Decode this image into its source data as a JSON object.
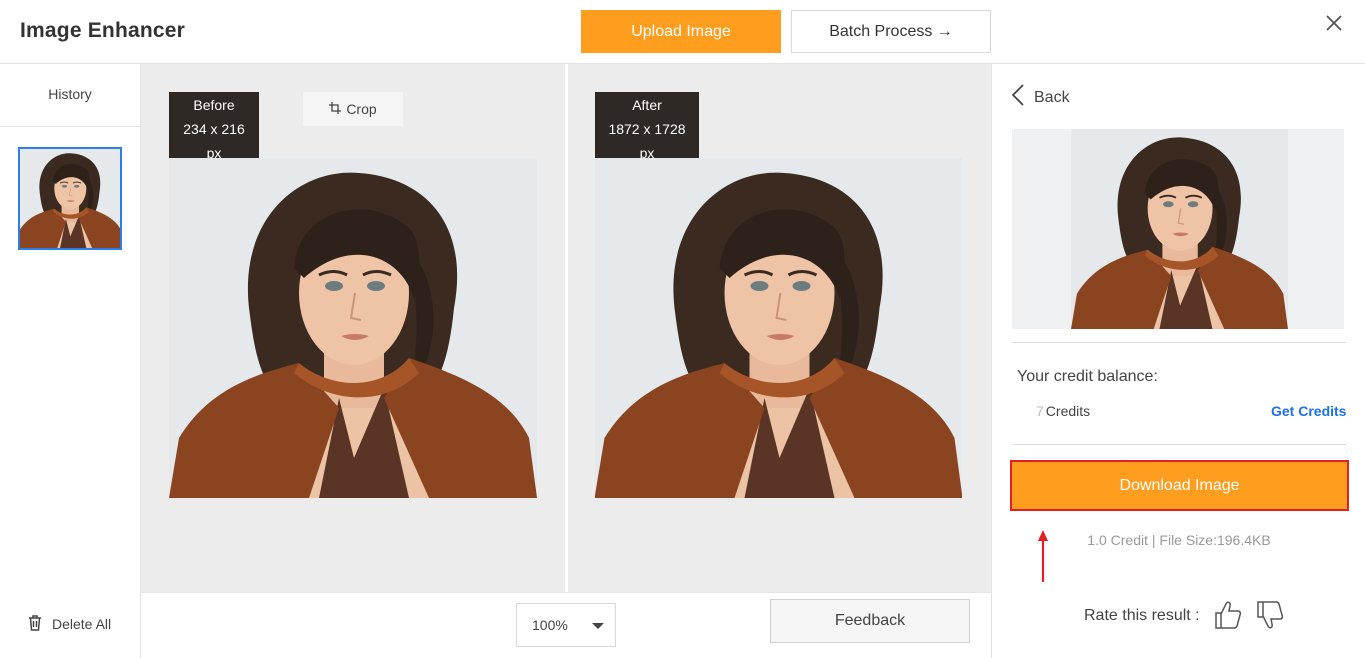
{
  "header": {
    "title": "Image Enhancer",
    "upload_label": "Upload Image",
    "batch_label": "Batch Process →"
  },
  "sidebar": {
    "history_label": "History",
    "delete_label": "Delete All"
  },
  "compare": {
    "before_label": "Before",
    "before_size": "234 x 216 px",
    "after_label": "After",
    "after_size": "1872 x 1728 px",
    "crop_label": "Crop"
  },
  "toolbar": {
    "zoom_value": "100%",
    "feedback_label": "Feedback"
  },
  "panel": {
    "back_label": "Back",
    "credit_title": "Your credit balance:",
    "credit_number": "7",
    "credit_unit": "Credits",
    "get_credits_label": "Get Credits",
    "download_label": "Download Image",
    "credit_info": "1.0 Credit | File Size:196.4KB",
    "rate_label": "Rate this result :"
  },
  "colors": {
    "accent": "#ff9d1e",
    "highlight_border": "#e31e24",
    "link": "#1a73e8",
    "selection": "#2b7de9"
  },
  "icons": [
    "close-icon",
    "trash-icon",
    "crop-icon",
    "chevron-left-icon",
    "caret-down-icon",
    "thumbs-up-icon",
    "thumbs-down-icon",
    "arrow-up-icon"
  ]
}
